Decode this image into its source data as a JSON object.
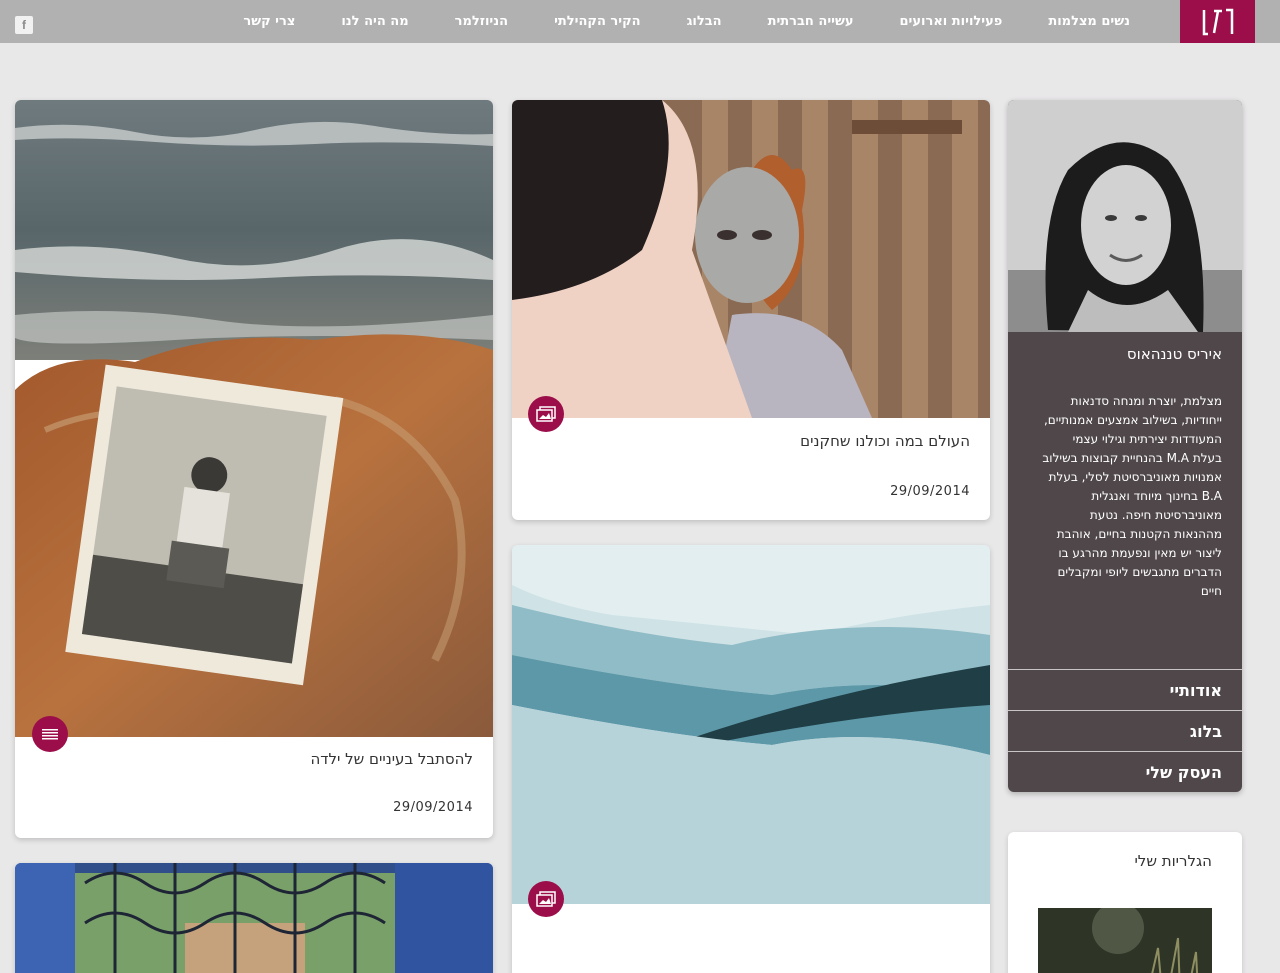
{
  "nav": {
    "items": [
      "נשים מצלמות",
      "פעילויות וארועים",
      "עשייה חברתית",
      "הבלוג",
      "הקיר הקהילתי",
      "הניוזלמר",
      "מה היה לנו",
      "צרי קשר"
    ],
    "facebook": "f"
  },
  "colors": {
    "brand": "#9b0e4a",
    "topbar": "#b2b1b1",
    "profile_bg": "#4f4749",
    "page_bg": "#e9e8e9"
  },
  "posts": [
    {
      "title": "להסתבל בעיניים של ילדה",
      "date": "29/09/2014",
      "badge_icon": "menu-lines-icon"
    },
    {
      "title": "העולם במה וכולנו שחקנים",
      "date": "29/09/2014",
      "badge_icon": "gallery-icon"
    },
    {
      "badge_icon": "gallery-icon"
    }
  ],
  "profile": {
    "name": "איריס טננהאוס",
    "bio": "מצלמת, יוצרת ומנחה סדנאות ייחודיות, בשילוב אמצעים אמנותיים, המעודדות יצירתית וגילוי עצמי בעלת M.A בהנחיית קבוצות בשילוב אמנויות מאוניברסיטת לסלי, בעלת B.A בחינוך מיוחד ואנגלית מאוניברסיטת חיפה. נטעת מההנאות הקטנות בחיים, אוהבת ליצור יש מאין ונפעמת מהרגע בו הדברים מתגבשים ליופי ומקבלים חיים",
    "links": [
      "אודותיי",
      "בלוג",
      "העסק שלי"
    ]
  },
  "galleries": {
    "title": "הגלריות שלי"
  }
}
